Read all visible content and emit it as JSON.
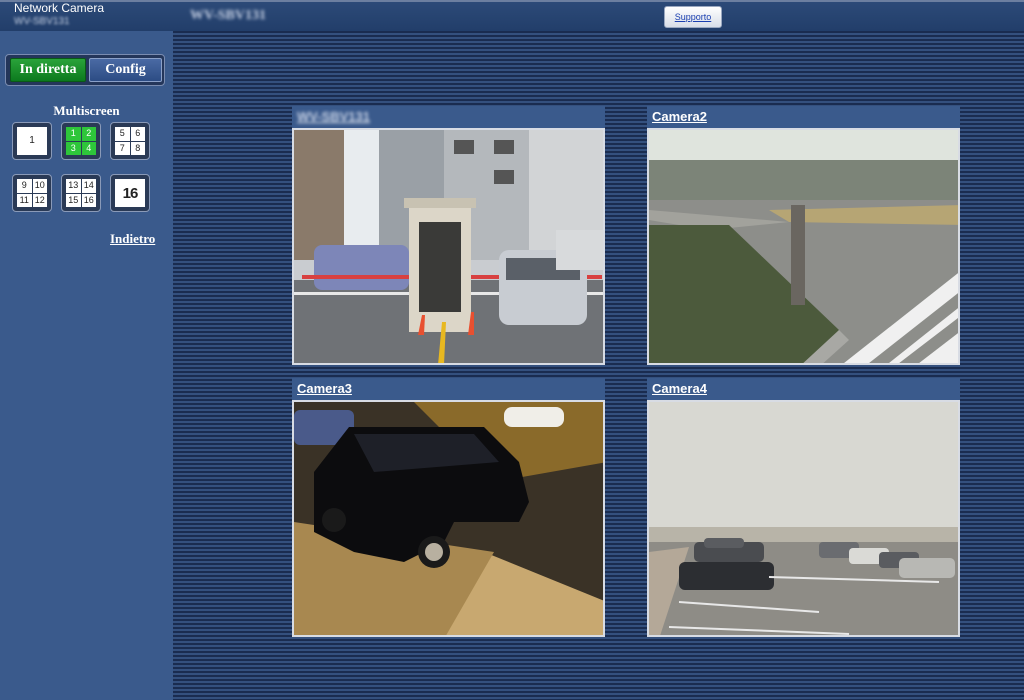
{
  "header": {
    "brand": "Network Camera",
    "brand_model": "WV-SBV131",
    "model_title": "WV-SBV131",
    "support_label": "Supporto"
  },
  "sidebar": {
    "tabs": {
      "live": "In diretta",
      "config": "Config"
    },
    "multiscreen_title": "Multiscreen",
    "layouts": {
      "single": [
        "1"
      ],
      "quad_1_4": [
        "1",
        "2",
        "3",
        "4"
      ],
      "quad_5_8": [
        "5",
        "6",
        "7",
        "8"
      ],
      "quad_9_12": [
        "9",
        "10",
        "11",
        "12"
      ],
      "quad_13_16": [
        "13",
        "14",
        "15",
        "16"
      ],
      "sixteen": [
        "16"
      ]
    },
    "back_label": "Indietro"
  },
  "cameras": [
    {
      "title": "WV-SBV131"
    },
    {
      "title": "Camera2"
    },
    {
      "title": "Camera3"
    },
    {
      "title": "Camera4"
    }
  ],
  "colors": {
    "active_tab": "#1a8a2a",
    "active_layout": "#2ec63a",
    "panel": "#3a5a8c"
  }
}
